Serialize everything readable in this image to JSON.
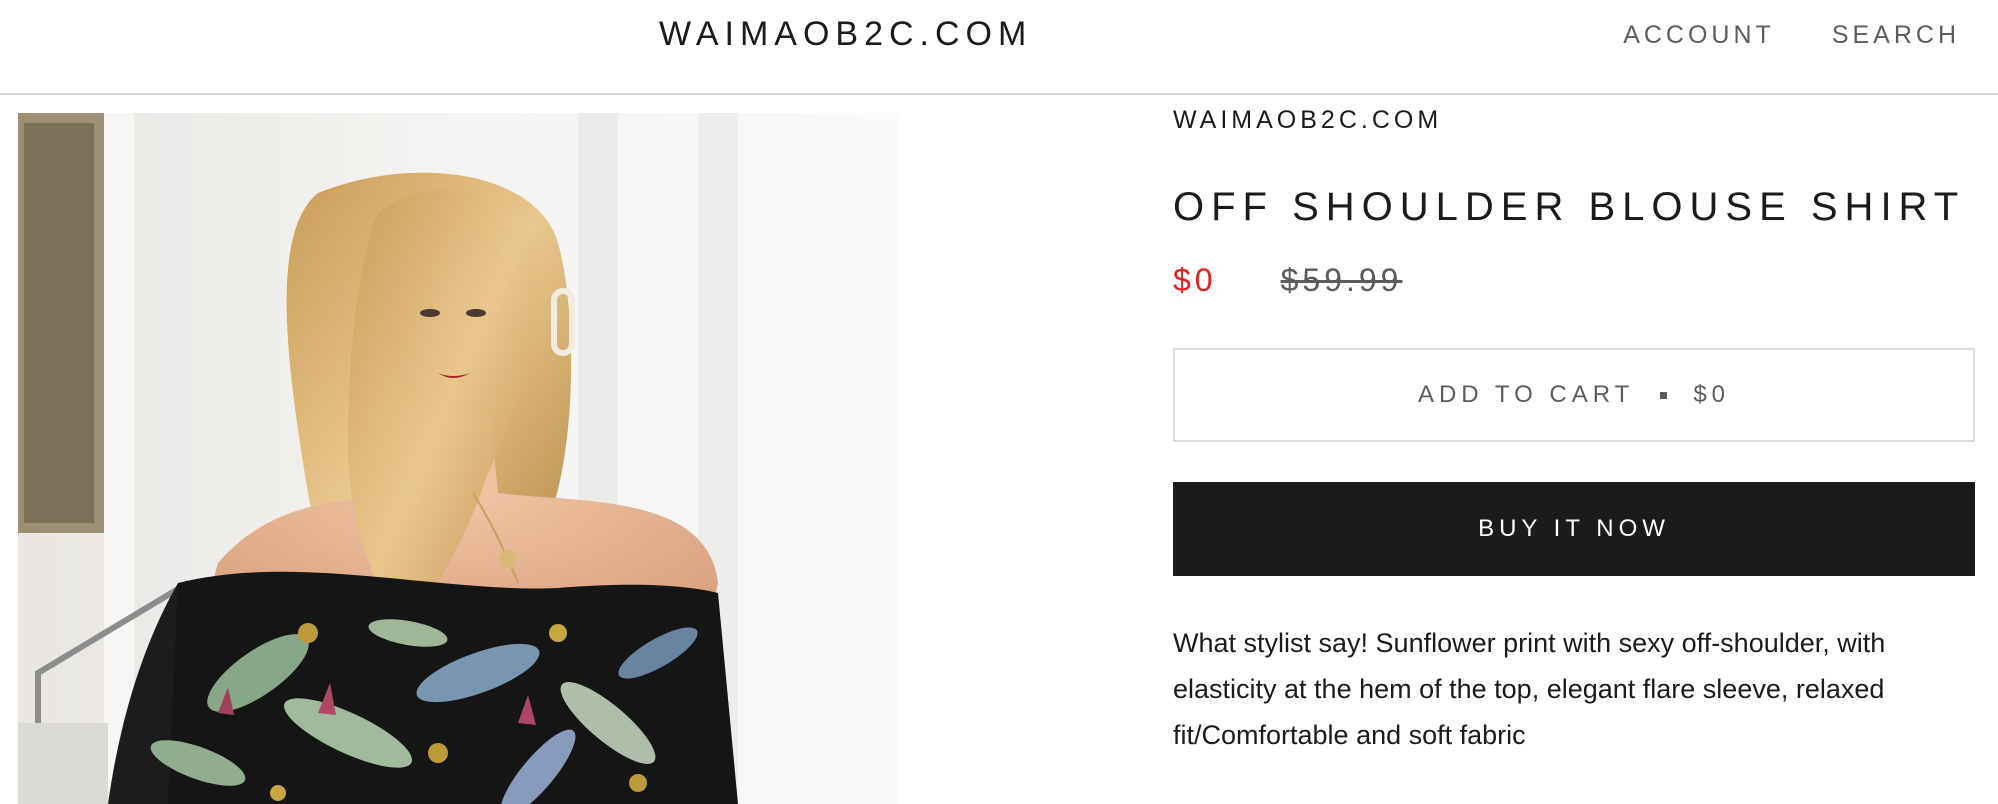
{
  "header": {
    "logo": "WAIMAOB2C.COM",
    "nav": {
      "account": "ACCOUNT",
      "search": "SEARCH"
    }
  },
  "product": {
    "vendor": "WAIMAOB2C.COM",
    "title": "OFF SHOULDER BLOUSE SHIRT",
    "price": "$0",
    "compare_price": "$59.99",
    "add_to_cart": {
      "label": "ADD TO CART",
      "price": "$0"
    },
    "buy_now": "BUY IT NOW",
    "description": "What stylist say!  Sunflower print with sexy off-shoulder, with elasticity at the hem of the top, elegant flare sleeve, relaxed fit/Comfortable and soft fabric"
  },
  "colors": {
    "sale_price": "#e22120",
    "button_dark": "#1c1b1b",
    "text_muted": "#5c5c5c",
    "border": "#dcdcdc"
  },
  "icons": {
    "separator": "bullet-dot-icon"
  }
}
